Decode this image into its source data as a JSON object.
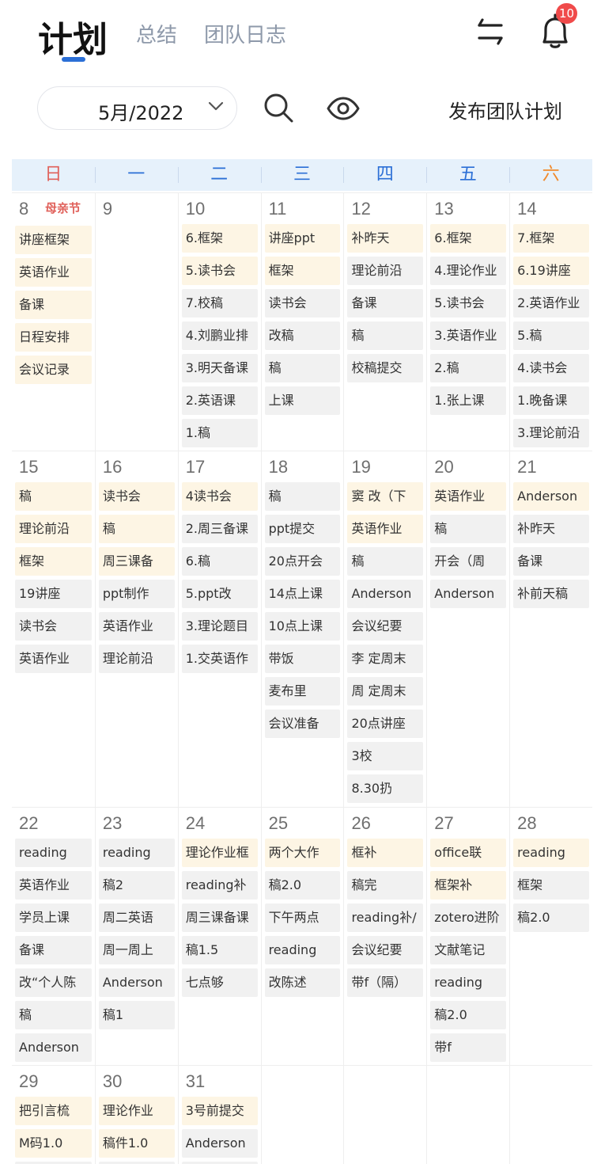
{
  "header": {
    "tabs": [
      {
        "label": "计划",
        "active": true
      },
      {
        "label": "总结",
        "active": false
      },
      {
        "label": "团队日志",
        "active": false
      }
    ],
    "notification_count": "10",
    "icons": {
      "swap": "swap-arrows-icon",
      "bell": "bell-icon"
    }
  },
  "toolbar": {
    "month_label": "5月/2022",
    "publish_label": "发布团队计划",
    "icons": {
      "dropdown": "chevron-down-icon",
      "search": "search-icon",
      "view": "eye-icon"
    }
  },
  "colors": {
    "accent": "#2b6fd6",
    "sunday": "#e0605a",
    "saturday": "#f08a2c",
    "badge": "#f04a4a",
    "task_highlight": "#fdf5e4",
    "task_normal": "#f1f1f1"
  },
  "weekdays": [
    "日",
    "一",
    "二",
    "三",
    "四",
    "五",
    "六"
  ],
  "weeks": [
    [
      {
        "day": "8",
        "holiday": "母亲节",
        "tasks": [
          {
            "t": "讲座框架",
            "c": "y"
          },
          {
            "t": "英语作业",
            "c": "y"
          },
          {
            "t": "备课",
            "c": "y"
          },
          {
            "t": "日程安排",
            "c": "y"
          },
          {
            "t": "会议记录",
            "c": "y"
          }
        ]
      },
      {
        "day": "9",
        "tasks": []
      },
      {
        "day": "10",
        "tasks": [
          {
            "t": "6.框架",
            "c": "y"
          },
          {
            "t": "5.读书会",
            "c": "y"
          },
          {
            "t": "7.校稿",
            "c": "g"
          },
          {
            "t": "4.刘鹏业排",
            "c": "g"
          },
          {
            "t": "3.明天备课",
            "c": "g"
          },
          {
            "t": "2.英语课",
            "c": "g"
          },
          {
            "t": "1.稿",
            "c": "g"
          }
        ]
      },
      {
        "day": "11",
        "tasks": [
          {
            "t": "讲座ppt",
            "c": "y"
          },
          {
            "t": "框架",
            "c": "y"
          },
          {
            "t": "读书会",
            "c": "g"
          },
          {
            "t": "改稿",
            "c": "g"
          },
          {
            "t": "稿",
            "c": "g"
          },
          {
            "t": "上课",
            "c": "g"
          }
        ]
      },
      {
        "day": "12",
        "tasks": [
          {
            "t": "补昨天",
            "c": "y"
          },
          {
            "t": "理论前沿",
            "c": "g"
          },
          {
            "t": "备课",
            "c": "g"
          },
          {
            "t": "稿",
            "c": "g"
          },
          {
            "t": "校稿提交",
            "c": "g"
          }
        ]
      },
      {
        "day": "13",
        "tasks": [
          {
            "t": "6.框架",
            "c": "y"
          },
          {
            "t": "4.理论作业",
            "c": "g"
          },
          {
            "t": "5.读书会",
            "c": "g"
          },
          {
            "t": "3.英语作业",
            "c": "g"
          },
          {
            "t": "2.稿",
            "c": "g"
          },
          {
            "t": "1.张上课",
            "c": "g"
          }
        ]
      },
      {
        "day": "14",
        "tasks": [
          {
            "t": "7.框架",
            "c": "y"
          },
          {
            "t": "6.19讲座",
            "c": "y"
          },
          {
            "t": "2.英语作业",
            "c": "g"
          },
          {
            "t": "5.稿",
            "c": "g"
          },
          {
            "t": "4.读书会",
            "c": "g"
          },
          {
            "t": "1.晚备课",
            "c": "g"
          },
          {
            "t": "3.理论前沿",
            "c": "g"
          }
        ]
      }
    ],
    [
      {
        "day": "15",
        "tasks": [
          {
            "t": "稿",
            "c": "y"
          },
          {
            "t": "理论前沿",
            "c": "y"
          },
          {
            "t": "框架",
            "c": "y"
          },
          {
            "t": "19讲座",
            "c": "g"
          },
          {
            "t": "读书会",
            "c": "g"
          },
          {
            "t": "英语作业",
            "c": "g"
          }
        ]
      },
      {
        "day": "16",
        "tasks": [
          {
            "t": "读书会",
            "c": "y"
          },
          {
            "t": "稿",
            "c": "y"
          },
          {
            "t": "周三课备",
            "c": "y"
          },
          {
            "t": "ppt制作",
            "c": "g"
          },
          {
            "t": "英语作业",
            "c": "g"
          },
          {
            "t": "理论前沿",
            "c": "g"
          }
        ]
      },
      {
        "day": "17",
        "tasks": [
          {
            "t": "4读书会",
            "c": "y"
          },
          {
            "t": "2.周三备课",
            "c": "g"
          },
          {
            "t": "6.稿",
            "c": "g"
          },
          {
            "t": "5.ppt改",
            "c": "g"
          },
          {
            "t": "3.理论题目",
            "c": "g"
          },
          {
            "t": "1.交英语作",
            "c": "g"
          }
        ]
      },
      {
        "day": "18",
        "tasks": [
          {
            "t": "稿",
            "c": "g"
          },
          {
            "t": "ppt提交",
            "c": "g"
          },
          {
            "t": "20点开会",
            "c": "g"
          },
          {
            "t": "14点上课",
            "c": "g"
          },
          {
            "t": "10点上课",
            "c": "g"
          },
          {
            "t": "带饭",
            "c": "g"
          },
          {
            "t": "麦布里",
            "c": "g"
          },
          {
            "t": "会议准备",
            "c": "g"
          }
        ]
      },
      {
        "day": "19",
        "tasks": [
          {
            "t": "窦 改（下",
            "c": "y"
          },
          {
            "t": "英语作业",
            "c": "y"
          },
          {
            "t": "稿",
            "c": "g"
          },
          {
            "t": "Anderson",
            "c": "g"
          },
          {
            "t": "会议纪要",
            "c": "g"
          },
          {
            "t": "李 定周末",
            "c": "g"
          },
          {
            "t": "周 定周末",
            "c": "g"
          },
          {
            "t": "20点讲座",
            "c": "g"
          },
          {
            "t": "3校",
            "c": "g"
          },
          {
            "t": "8.30扔",
            "c": "g"
          }
        ]
      },
      {
        "day": "20",
        "tasks": [
          {
            "t": "英语作业",
            "c": "y"
          },
          {
            "t": "稿",
            "c": "g"
          },
          {
            "t": "开会（周",
            "c": "g"
          },
          {
            "t": "Anderson",
            "c": "g"
          }
        ]
      },
      {
        "day": "21",
        "tasks": [
          {
            "t": "Anderson",
            "c": "y"
          },
          {
            "t": "补昨天",
            "c": "g"
          },
          {
            "t": "备课",
            "c": "g"
          },
          {
            "t": "补前天稿",
            "c": "g"
          }
        ]
      }
    ],
    [
      {
        "day": "22",
        "tasks": [
          {
            "t": "reading",
            "c": "g"
          },
          {
            "t": "英语作业",
            "c": "g"
          },
          {
            "t": "学员上课",
            "c": "g"
          },
          {
            "t": "备课",
            "c": "g"
          },
          {
            "t": "改“个人陈",
            "c": "g"
          },
          {
            "t": "稿",
            "c": "g"
          },
          {
            "t": "Anderson",
            "c": "g"
          }
        ]
      },
      {
        "day": "23",
        "tasks": [
          {
            "t": "reading",
            "c": "g"
          },
          {
            "t": "稿2",
            "c": "g"
          },
          {
            "t": "周二英语",
            "c": "g"
          },
          {
            "t": "周一周上",
            "c": "g"
          },
          {
            "t": "Anderson",
            "c": "g"
          },
          {
            "t": "稿1",
            "c": "g"
          }
        ]
      },
      {
        "day": "24",
        "tasks": [
          {
            "t": "理论作业框",
            "c": "y"
          },
          {
            "t": "reading补",
            "c": "g"
          },
          {
            "t": "周三课备课",
            "c": "g"
          },
          {
            "t": "稿1.5",
            "c": "g"
          },
          {
            "t": "七点够",
            "c": "g"
          }
        ]
      },
      {
        "day": "25",
        "tasks": [
          {
            "t": "两个大作",
            "c": "y"
          },
          {
            "t": "稿2.0",
            "c": "g"
          },
          {
            "t": "下午两点",
            "c": "g"
          },
          {
            "t": "reading",
            "c": "g"
          },
          {
            "t": "改陈述",
            "c": "g"
          }
        ]
      },
      {
        "day": "26",
        "tasks": [
          {
            "t": "框补",
            "c": "y"
          },
          {
            "t": "稿完",
            "c": "g"
          },
          {
            "t": "reading补/",
            "c": "g"
          },
          {
            "t": "会议纪要",
            "c": "g"
          },
          {
            "t": "带f（隔）",
            "c": "g"
          }
        ]
      },
      {
        "day": "27",
        "tasks": [
          {
            "t": "office联",
            "c": "y"
          },
          {
            "t": "框架补",
            "c": "y"
          },
          {
            "t": "zotero进阶",
            "c": "g"
          },
          {
            "t": "文献笔记",
            "c": "g"
          },
          {
            "t": "reading",
            "c": "g"
          },
          {
            "t": "稿2.0",
            "c": "g"
          },
          {
            "t": "带f",
            "c": "g"
          }
        ]
      },
      {
        "day": "28",
        "tasks": [
          {
            "t": "reading",
            "c": "y"
          },
          {
            "t": "框架",
            "c": "g"
          },
          {
            "t": "稿2.0",
            "c": "g"
          }
        ]
      }
    ],
    [
      {
        "day": "29",
        "tasks": [
          {
            "t": "把引言梳",
            "c": "y"
          },
          {
            "t": "M码1.0",
            "c": "y"
          },
          {
            "t": "",
            "c": "g"
          }
        ]
      },
      {
        "day": "30",
        "tasks": [
          {
            "t": "理论作业",
            "c": "y"
          },
          {
            "t": "稿件1.0",
            "c": "y"
          },
          {
            "t": "",
            "c": "g"
          }
        ]
      },
      {
        "day": "31",
        "tasks": [
          {
            "t": "3号前提交",
            "c": "y"
          },
          {
            "t": "Anderson",
            "c": "g"
          },
          {
            "t": "",
            "c": "g"
          }
        ]
      },
      null,
      null,
      null,
      null
    ]
  ]
}
